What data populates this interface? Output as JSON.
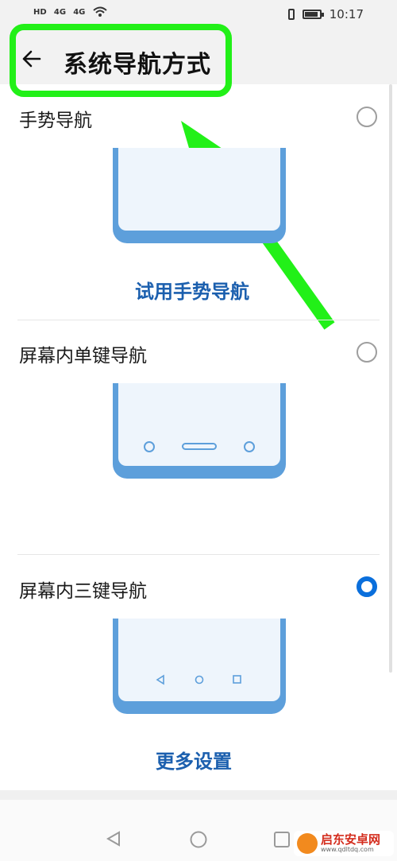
{
  "status_bar": {
    "signal_labels": [
      "HD",
      "4G",
      "4G"
    ],
    "time": "10:17"
  },
  "header": {
    "title": "系统导航方式",
    "back_icon": "arrow-left-icon"
  },
  "options": [
    {
      "label": "手势导航",
      "selected": false,
      "action_label": "试用手势导航"
    },
    {
      "label": "屏幕内单键导航",
      "selected": false
    },
    {
      "label": "屏幕内三键导航",
      "selected": true,
      "action_label": "更多设置"
    }
  ],
  "annotation": {
    "color": "#22f018"
  },
  "accent_color": "#0a6fdc",
  "link_color": "#1b5fae",
  "watermark": {
    "title": "启东安卓网",
    "url": "www.qdltdq.com"
  },
  "nav_icons": [
    "back-triangle-icon",
    "home-circle-icon",
    "recent-square-icon"
  ]
}
